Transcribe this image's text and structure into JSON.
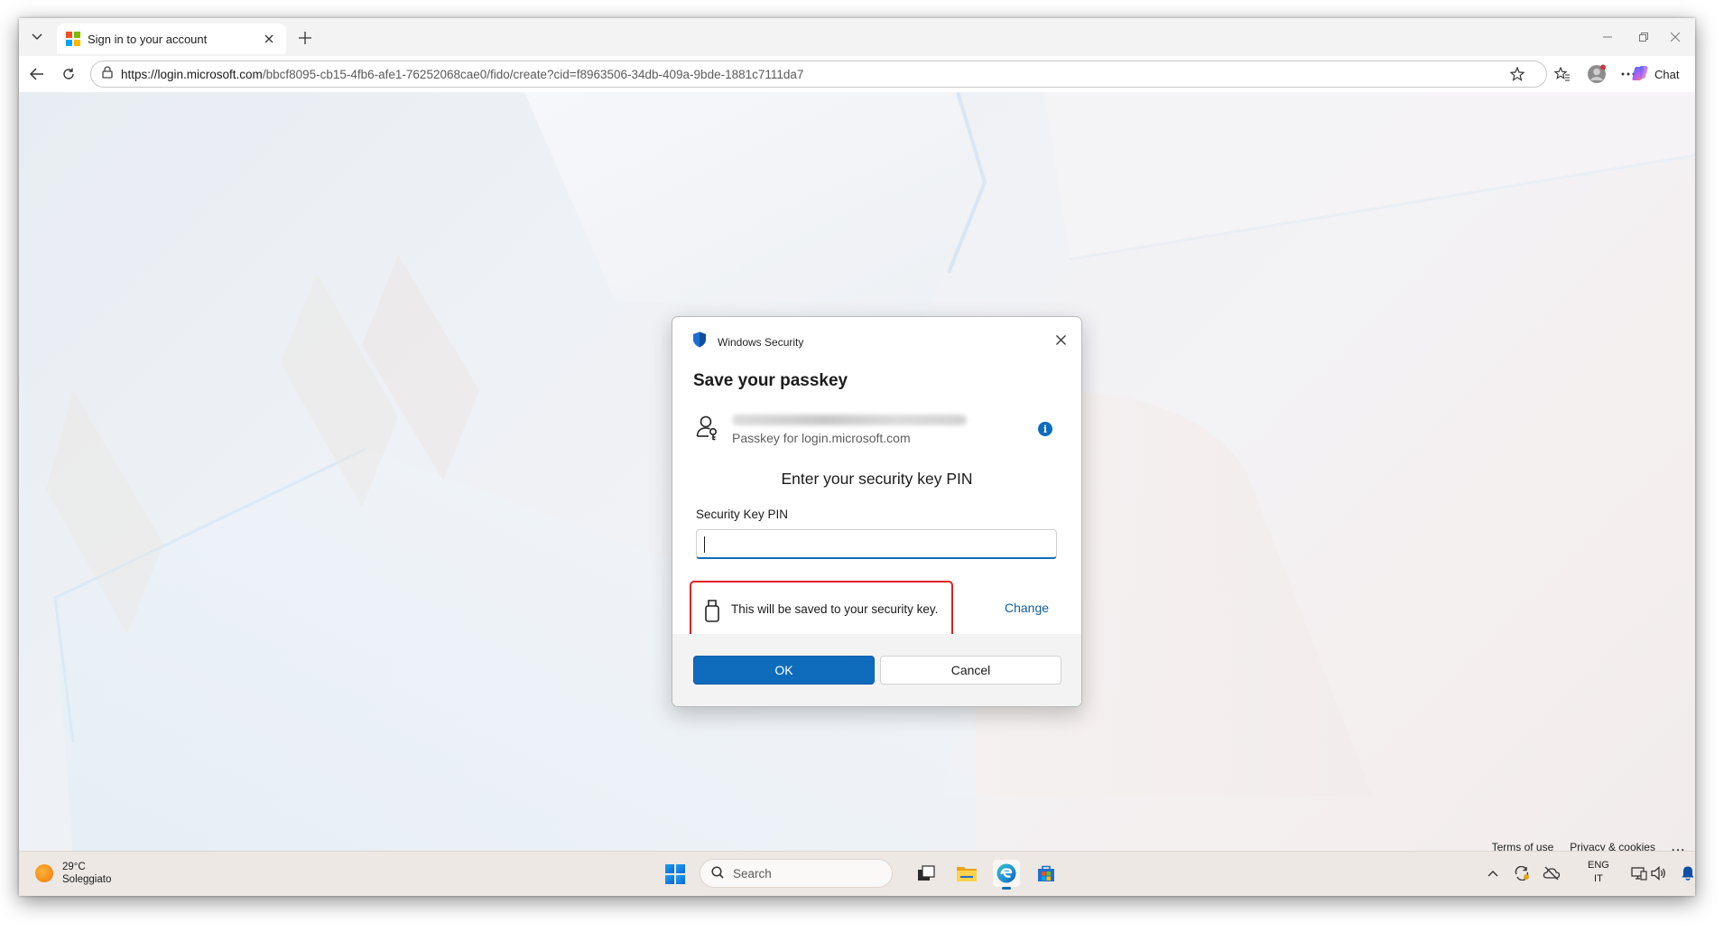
{
  "browser": {
    "tab_title": "Sign in to your account",
    "url_host": "https://login.microsoft.com",
    "url_path": "/bbcf8095-cb15-4fb6-afe1-76252068cae0/fido/create?cid=f8963506-34db-409a-9bde-1881c7111da7",
    "chat_label": "Chat"
  },
  "dialog": {
    "app_name": "Windows Security",
    "title": "Save your passkey",
    "account_subtitle": "Passkey for login.microsoft.com",
    "heading": "Enter your security key PIN",
    "pin_label": "Security Key PIN",
    "pin_value": "",
    "save_note": "This will be saved to your security key.",
    "change_label": "Change",
    "ok_label": "OK",
    "cancel_label": "Cancel"
  },
  "page_footer": {
    "terms": "Terms of use",
    "privacy": "Privacy & cookies",
    "more": "..."
  },
  "taskbar": {
    "temperature": "29°C",
    "weather": "Soleggiato",
    "search_placeholder": "Search",
    "lang_top": "ENG",
    "lang_bottom": "IT"
  },
  "colors": {
    "accent": "#0f6cbd",
    "highlight_border": "#e02020",
    "shield": "#1c6fd1"
  }
}
